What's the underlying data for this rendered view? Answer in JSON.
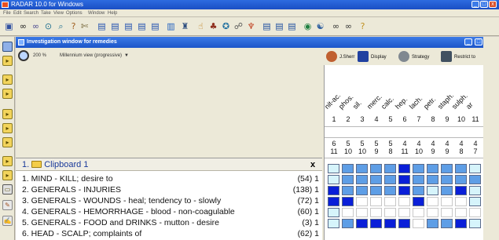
{
  "window": {
    "title": "RADAR 10.0 for Windows"
  },
  "menu": [
    "File",
    "Edit",
    "Search",
    "Take",
    "View",
    "Options",
    "Window",
    "Help"
  ],
  "inner_window": {
    "title": "Investigation window for remedies"
  },
  "options": {
    "zoom": "200 %",
    "view": "Millennium view (progressive)",
    "dropdown": "▼"
  },
  "right_buttons": [
    {
      "label": "J.Sherr"
    },
    {
      "label": "Display"
    },
    {
      "label": "Strategy"
    },
    {
      "label": "Restrict to"
    }
  ],
  "clipboard": {
    "title": "1.",
    "name": "Clipboard 1",
    "close": "x",
    "rubrics": [
      {
        "text": "1. MIND - KILL; desire to",
        "count": "(54) 1"
      },
      {
        "text": "2. GENERALS - INJURIES",
        "count": "(138) 1"
      },
      {
        "text": "3. GENERALS - WOUNDS - heal; tendency to - slowly",
        "count": "(72) 1"
      },
      {
        "text": "4. GENERALS - HEMORRHAGE - blood - non-coagulable",
        "count": "(60) 1"
      },
      {
        "text": "5. GENERALS - FOOD and DRINKS - mutton - desire",
        "count": "(3) 1"
      },
      {
        "text": "6. HEAD - SCALP; complaints of",
        "count": "(62) 1"
      }
    ]
  },
  "remedies": [
    "nit-ac.",
    "phos.",
    "sil.",
    "merc.",
    "calc.",
    "hep.",
    "lach.",
    "petr.",
    "staph.",
    "sulph.",
    "ar"
  ],
  "remedy_index": [
    "1",
    "2",
    "3",
    "4",
    "5",
    "6",
    "7",
    "8",
    "9",
    "10",
    "11"
  ],
  "scores": [
    "6",
    "5",
    "5",
    "5",
    "5",
    "4",
    "4",
    "4",
    "4",
    "4",
    "4"
  ],
  "degrees": [
    "11",
    "10",
    "10",
    "9",
    "8",
    "11",
    "10",
    "9",
    "9",
    "8",
    "7"
  ],
  "grid_levels": [
    [
      1,
      2,
      2,
      2,
      2,
      3,
      2,
      2,
      2,
      2,
      1
    ],
    [
      1,
      2,
      2,
      2,
      2,
      3,
      2,
      2,
      2,
      2,
      2
    ],
    [
      3,
      2,
      2,
      2,
      2,
      3,
      2,
      1,
      2,
      3,
      1
    ],
    [
      3,
      3,
      0,
      0,
      0,
      0,
      3,
      0,
      0,
      0,
      1
    ],
    [
      1,
      0,
      0,
      0,
      0,
      0,
      0,
      0,
      0,
      0,
      0
    ],
    [
      1,
      2,
      3,
      3,
      3,
      3,
      0,
      2,
      2,
      3,
      1
    ]
  ],
  "colors": {
    "level_0": "#ffffff",
    "level_1": "#d6f4fb",
    "level_2": "#5e9ee6",
    "level_3": "#0a1fd8"
  },
  "icons": [
    "new-icon",
    "binoculars-icon",
    "search-icon",
    "magnifier-icon",
    "question-icon",
    "repertory-icon",
    "book-icon",
    "chart-icon",
    "help-icon"
  ]
}
